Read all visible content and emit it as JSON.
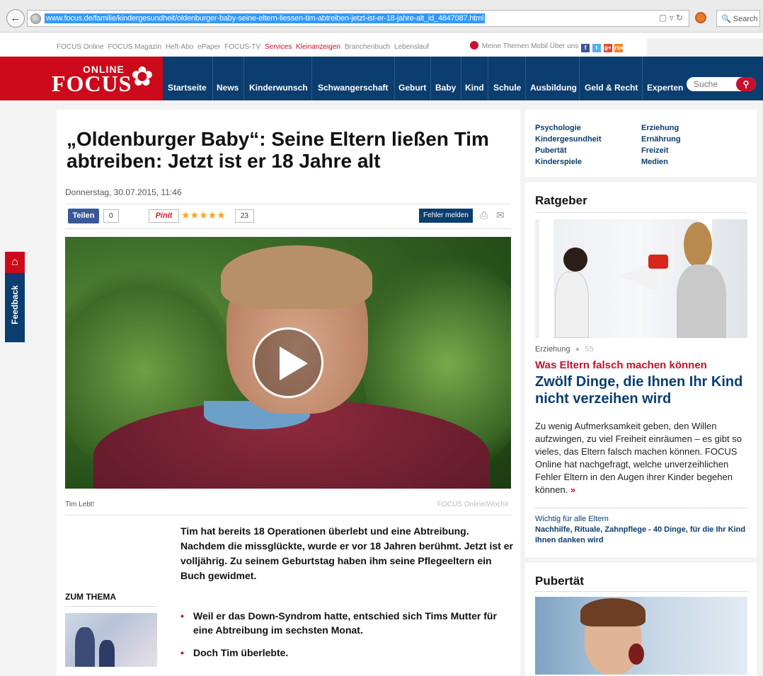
{
  "browser": {
    "url": "www.focus.de/familie/kindergesundheit/oldenburger-baby-seine-eltern-liessen-tim-abtreiben-jetzt-ist-er-18-jahre-alt_id_4847087.html",
    "search_placeholder": "Search",
    "icons": [
      "back-arrow-icon",
      "globe-icon",
      "reader-icon",
      "dropdown-icon",
      "reload-icon",
      "addon-icon",
      "search-icon"
    ]
  },
  "toplinks": {
    "left": [
      "FOCUS Online",
      "FOCUS Magazin",
      "Heft-Abo",
      "ePaper",
      "FOCUS-TV",
      "Services",
      "Kleinanzeigen",
      "Branchenbuch",
      "Lebenslauf"
    ],
    "right": [
      "Meine Themen",
      "Mobil",
      "Über uns"
    ],
    "social": [
      "f",
      "t",
      "g+",
      "rss"
    ]
  },
  "header": {
    "logo_online": "ONLINE",
    "logo_focus": "FOCUS",
    "nav": [
      "Startseite",
      "News",
      "Kinderwunsch",
      "Schwangerschaft",
      "Geburt",
      "Baby",
      "Kind",
      "Schule",
      "Ausbildung",
      "Geld & Recht",
      "Experten"
    ],
    "search_placeholder": "Suche",
    "colors": {
      "red": "#cc0a1c",
      "navy": "#0b3d6e"
    }
  },
  "article": {
    "headline": "„Oldenburger Baby“: Seine Eltern ließen Tim abtreiben: Jetzt ist er 18 Jahre alt",
    "date": "Donnerstag, 30.07.2015, 11:46",
    "share_label": "Teilen",
    "share_count": "0",
    "pin_label": "Pinit",
    "stars": "★★★★★",
    "rating_count": "23",
    "error_label": "Fehler melden",
    "caption": "Tim Lebt!",
    "credit": "FOCUS Online/Wochit",
    "lead": "Tim hat bereits 18 Operationen überlebt und eine Abtreibung. Nachdem die missglückte, wurde er vor 18 Jahren berühmt. Jetzt ist er volljährig. Zu seinem Geburtstag haben ihm seine Pflegeeltern ein Buch gewidmet.",
    "zum_thema": "ZUM THEMA",
    "bullets": [
      "Weil er das Down-Syndrom hatte, entschied sich Tims Mutter für eine Abtreibung im sechsten Monat.",
      "Doch Tim überlebte."
    ]
  },
  "sidebar": {
    "links": [
      "Psychologie",
      "Erziehung",
      "Kindergesundheit",
      "Ernährung",
      "Pubertät",
      "Freizeit",
      "Kinderspiele",
      "Medien"
    ],
    "ratgeber": {
      "title": "Ratgeber",
      "meta_category": "Erziehung",
      "meta_comments": "55",
      "kicker": "Was Eltern falsch machen können",
      "headline": "Zwölf Dinge, die Ihnen Ihr Kind nicht verzeihen wird",
      "text": "Zu wenig Aufmerksamkeit geben, den Willen aufzwingen, zu viel Freiheit einräumen – es gibt so vieles, das Eltern falsch machen können. FOCUS Online hat nachgefragt, welche unverzeihlichen Fehler Eltern in den Augen ihrer Kinder begehen können.",
      "more": "»",
      "sub_kicker": "Wichtig für alle Eltern",
      "sub_headline": "Nachhilfe, Rituale, Zahnpflege - 40 Dinge, für die Ihr Kind Ihnen danken wird"
    },
    "pubertaet": {
      "title": "Pubertät"
    }
  },
  "feedback": {
    "label": "Feedback"
  }
}
